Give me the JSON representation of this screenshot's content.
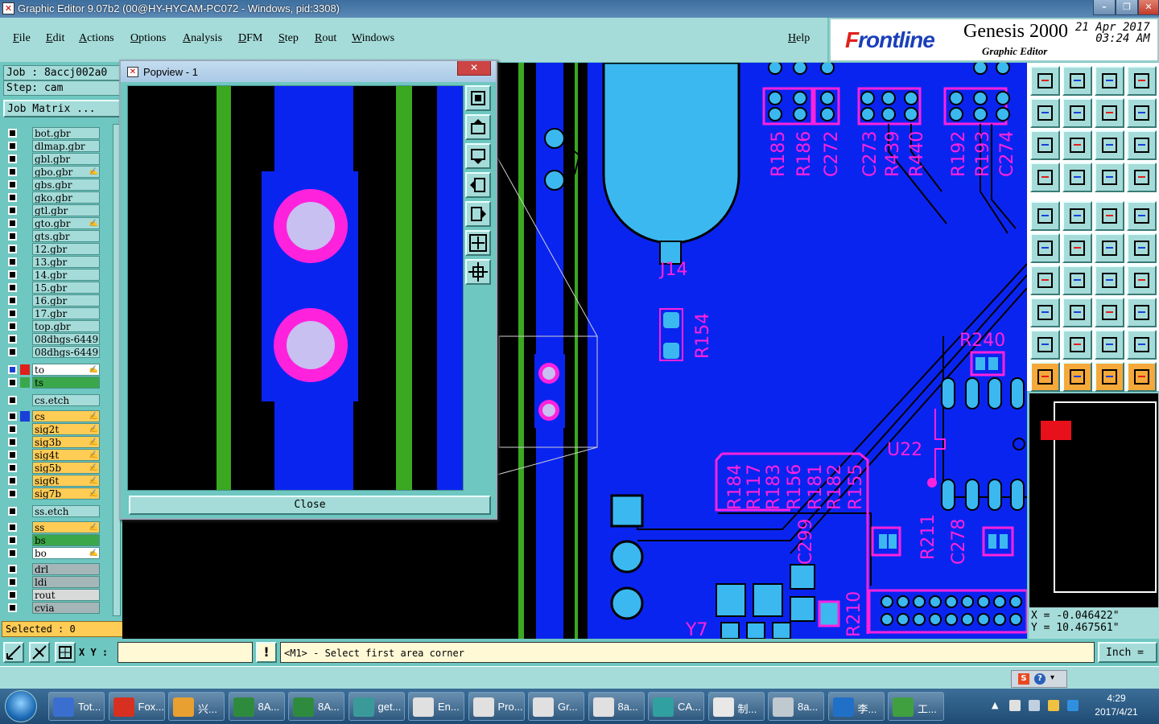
{
  "window": {
    "title": "Graphic Editor 9.07b2 (00@HY-HYCAM-PC072 - Windows, pid:3308)",
    "min": "–",
    "max": "❐",
    "close": "✕"
  },
  "menu": {
    "items": [
      "File",
      "Edit",
      "Actions",
      "Options",
      "Analysis",
      "DFM",
      "Step",
      "Rout",
      "Windows"
    ],
    "help": "Help"
  },
  "brand": {
    "logo_a": "F",
    "logo_b": "rontline",
    "product": "Genesis 2000",
    "subtitle": "Graphic Editor",
    "date": "21 Apr 2017",
    "time": "03:24 AM"
  },
  "job": {
    "job_label": "Job  : 8accj002a0",
    "step_label": "Step: cam",
    "matrix_button": "Job Matrix ..."
  },
  "layers": [
    {
      "name": "bot.gbr"
    },
    {
      "name": "dlmap.gbr"
    },
    {
      "name": "gbl.gbr"
    },
    {
      "name": "gbo.gbr",
      "pen": true
    },
    {
      "name": "gbs.gbr"
    },
    {
      "name": "gko.gbr"
    },
    {
      "name": "gtl.gbr"
    },
    {
      "name": "gto.gbr",
      "pen": true
    },
    {
      "name": "gts.gbr"
    },
    {
      "name": "12.gbr"
    },
    {
      "name": "13.gbr"
    },
    {
      "name": "14.gbr"
    },
    {
      "name": "15.gbr"
    },
    {
      "name": "16.gbr"
    },
    {
      "name": "17.gbr"
    },
    {
      "name": "top.gbr"
    },
    {
      "name": "08dhgs-64490"
    },
    {
      "name": "08dhgs-64490"
    }
  ],
  "board_layers": [
    {
      "name": "to",
      "bg": "#ffffff",
      "swatch": "#e0201a",
      "active": true
    },
    {
      "name": "ts",
      "bg": "#3aa84a",
      "swatch": "#3aa84a"
    },
    {
      "name": "cs.etch",
      "bg": "#a5dcd9"
    },
    {
      "name": "cs",
      "bg": "#ffcc55",
      "swatch": "#1a3fd8"
    },
    {
      "name": "sig2t",
      "bg": "#ffcc55"
    },
    {
      "name": "sig3b",
      "bg": "#ffcc55"
    },
    {
      "name": "sig4t",
      "bg": "#ffcc55"
    },
    {
      "name": "sig5b",
      "bg": "#ffcc55"
    },
    {
      "name": "sig6t",
      "bg": "#ffcc55"
    },
    {
      "name": "sig7b",
      "bg": "#ffcc55"
    },
    {
      "name": "ss.etch",
      "bg": "#a5dcd9"
    },
    {
      "name": "ss",
      "bg": "#ffcc55"
    },
    {
      "name": "bs",
      "bg": "#3aa84a"
    },
    {
      "name": "bo",
      "bg": "#ffffff"
    },
    {
      "name": "drl",
      "bg": "#a5b6b8"
    },
    {
      "name": "ldi",
      "bg": "#a5b6b8"
    },
    {
      "name": "rout",
      "bg": "#d8dada"
    },
    {
      "name": "cvia",
      "bg": "#a5b6b8"
    }
  ],
  "selected": "Selected : 0",
  "popview": {
    "title": "Popview - 1",
    "close_label": "Close"
  },
  "refdes": {
    "r185": "R185",
    "r186": "R186",
    "c272": "C272",
    "c273": "C273",
    "r439": "R439",
    "r440": "R440",
    "r192": "R192",
    "r193": "R193",
    "c274": "C274",
    "j14": "J14",
    "r154": "R154",
    "r240": "R240",
    "u22": "U22",
    "r184": "R184",
    "r117": "R117",
    "r183": "R183",
    "r156": "R156",
    "r181": "R181",
    "r182": "R182",
    "r155": "R155",
    "c299": "C299",
    "r210": "R210",
    "r211": "R211",
    "c278": "C278",
    "y7": "Y7"
  },
  "coords": {
    "x": "X = -0.046422\"",
    "y": "Y = 10.467561\""
  },
  "cmd": {
    "xy_label": "X Y :",
    "xy_value": "",
    "prompt": "<M1> - Select first area corner",
    "unit": "Inch ="
  },
  "taskbar": {
    "items": [
      {
        "label": "Tot...",
        "color": "#3a6fd0"
      },
      {
        "label": "Fox...",
        "color": "#d83020"
      },
      {
        "label": "兴...",
        "color": "#e8a030"
      },
      {
        "label": "8A...",
        "color": "#2e8b3e"
      },
      {
        "label": "8A...",
        "color": "#2e8b3e"
      },
      {
        "label": "get...",
        "color": "#3a9a9a"
      },
      {
        "label": "En...",
        "color": "#e0e0e0"
      },
      {
        "label": "Pro...",
        "color": "#e0e0e0"
      },
      {
        "label": "Gr...",
        "color": "#e0e0e0"
      },
      {
        "label": "8a...",
        "color": "#e0e0e0"
      },
      {
        "label": "CA...",
        "color": "#30a0a0"
      },
      {
        "label": "制...",
        "color": "#e8e8e8"
      },
      {
        "label": "8a...",
        "color": "#c0c8d0"
      },
      {
        "label": "李...",
        "color": "#2070c8"
      },
      {
        "label": "工...",
        "color": "#40a040"
      }
    ],
    "time": "4:29",
    "date": "2017/4/21"
  },
  "colors": {
    "copper": "#0a24f0",
    "silk": "#ff22dd",
    "pad": "#3bb8f0",
    "trace_green": "#3aa820"
  }
}
